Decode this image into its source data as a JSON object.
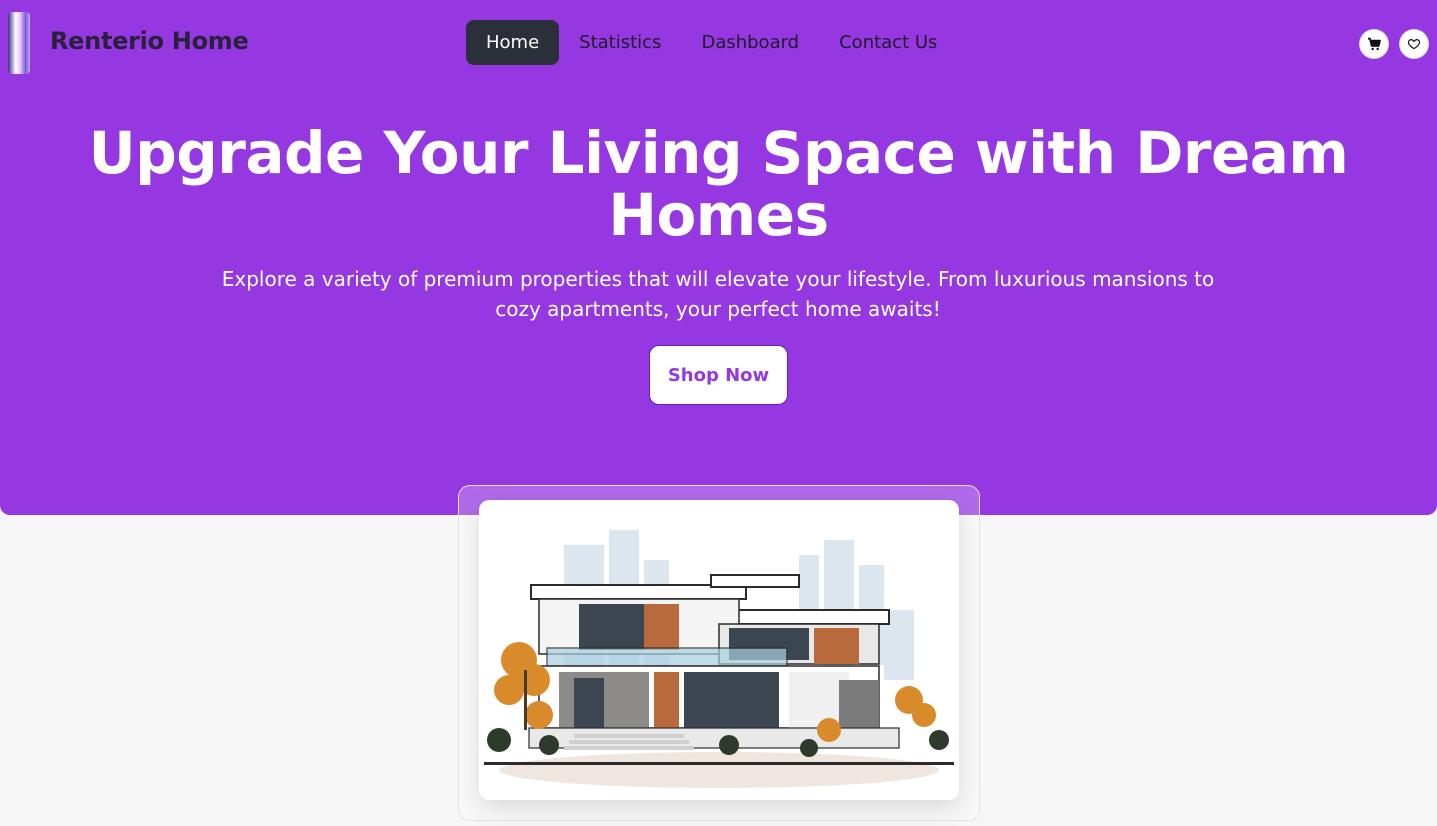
{
  "brand": {
    "name": "Renterio Home"
  },
  "nav": {
    "links": [
      {
        "label": "Home",
        "active": true
      },
      {
        "label": "Statistics",
        "active": false
      },
      {
        "label": "Dashboard",
        "active": false
      },
      {
        "label": "Contact Us",
        "active": false
      }
    ],
    "icons": [
      "cart-icon",
      "heart-icon"
    ]
  },
  "hero": {
    "title": "Upgrade Your Living Space with Dream Homes",
    "subtitle": "Explore a variety of premium properties that will elevate your lifestyle. From luxurious mansions to cozy apartments, your perfect home awaits!",
    "cta_label": "Shop Now"
  },
  "colors": {
    "primary": "#9538e2",
    "nav_active_bg": "#2b2f3a",
    "page_bg": "#f6f6f6"
  }
}
